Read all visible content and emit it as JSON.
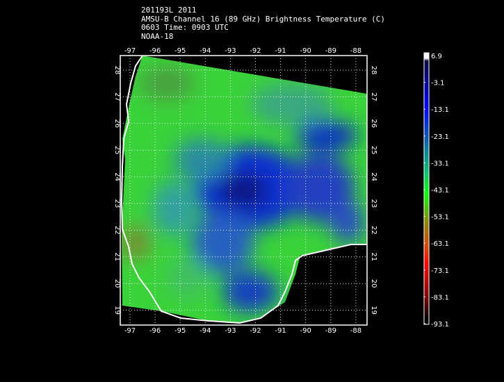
{
  "header": {
    "line1": "201193L 2011",
    "line2": "AMSU-B Channel 16 (89 GHz) Brightness Temperature (C)",
    "line3": "0603 Time: 0903 UTC",
    "line4": "NOAA-18"
  },
  "map": {
    "lon_ticks": [
      "-97",
      "-96",
      "-95",
      "-94",
      "-93",
      "-92",
      "-91",
      "-90",
      "-89",
      "-88"
    ],
    "lat_ticks": [
      "28",
      "27",
      "26",
      "25",
      "24",
      "23",
      "22",
      "21",
      "20",
      "19"
    ]
  },
  "colorbar": {
    "labels": [
      "6.9",
      "-3.1",
      "-13.1",
      "-23.1",
      "-33.1",
      "-43.1",
      "-53.1",
      "-63.1",
      "-73.1",
      "-83.1",
      "-93.1"
    ],
    "unit": "C",
    "colors": [
      "#ffffff",
      "#0a0a50",
      "#0000ff",
      "#0070a0",
      "#00c060",
      "#00ff00",
      "#8a8a00",
      "#d04000",
      "#ff0000",
      "#900000",
      "#000000"
    ]
  }
}
